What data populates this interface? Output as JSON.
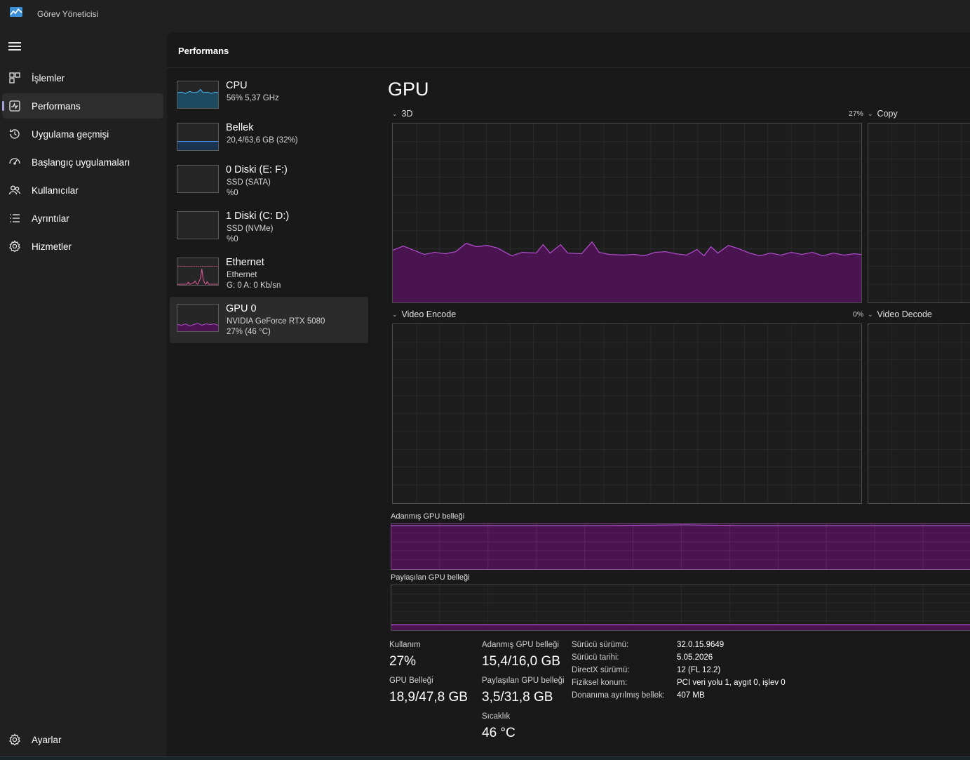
{
  "window": {
    "title": "Görev Yöneticisi"
  },
  "nav": {
    "items": [
      {
        "label": "İşlemler",
        "icon": "processes-icon"
      },
      {
        "label": "Performans",
        "icon": "performance-icon",
        "active": true
      },
      {
        "label": "Uygulama geçmişi",
        "icon": "history-icon"
      },
      {
        "label": "Başlangıç uygulamaları",
        "icon": "startup-icon"
      },
      {
        "label": "Kullanıcılar",
        "icon": "users-icon"
      },
      {
        "label": "Ayrıntılar",
        "icon": "details-icon"
      },
      {
        "label": "Hizmetler",
        "icon": "services-icon"
      }
    ],
    "settings_label": "Ayarlar"
  },
  "page": {
    "title": "Performans"
  },
  "resources": [
    {
      "name": "CPU",
      "sub1": "56% 5,37 GHz",
      "sub2": "",
      "color": "#4cc2ff"
    },
    {
      "name": "Bellek",
      "sub1": "20,4/63,6 GB (32%)",
      "sub2": "",
      "color": "#4ea1f7"
    },
    {
      "name": "0 Diski (E: F:)",
      "sub1": "SSD (SATA)",
      "sub2": "%0",
      "color": "#7a7a7a"
    },
    {
      "name": "1 Diski (C: D:)",
      "sub1": "SSD (NVMe)",
      "sub2": "%0",
      "color": "#7a7a7a"
    },
    {
      "name": "Ethernet",
      "sub1": "Ethernet",
      "sub2": "G: 0 A: 0 Kb/sn",
      "color": "#e85d9f"
    },
    {
      "name": "GPU 0",
      "sub1": "NVIDIA GeForce RTX 5080",
      "sub2": "27%  (46 °C)",
      "color": "#b64fd4",
      "selected": true
    }
  ],
  "detail": {
    "title": "GPU",
    "engines": [
      {
        "label": "3D",
        "percent": "27%",
        "usage": 27
      },
      {
        "label": "Copy"
      },
      {
        "label": "Video Encode",
        "percent": "0%",
        "usage": 0
      },
      {
        "label": "Video Decode"
      }
    ],
    "dedicated_memory_label": "Adanmış GPU belleği",
    "shared_memory_label": "Paylaşılan GPU belleği"
  },
  "stats": {
    "usage_label": "Kullanım",
    "usage_value": "27%",
    "gpu_memory_label": "GPU Belleği",
    "gpu_memory_value": "18,9/47,8 GB",
    "dedicated_label": "Adanmış GPU belleği",
    "dedicated_value": "15,4/16,0 GB",
    "shared_label": "Paylaşılan GPU belleği",
    "shared_value": "3,5/31,8 GB",
    "temp_label": "Sıcaklık",
    "temp_value": "46 °C"
  },
  "info": [
    {
      "key": "Sürücü sürümü:",
      "value": "32.0.15.9649"
    },
    {
      "key": "Sürücü tarihi:",
      "value": "5.05.2026"
    },
    {
      "key": "DirectX sürümü:",
      "value": "12 (FL 12.2)"
    },
    {
      "key": "Fiziksel konum:",
      "value": "PCI veri yolu 1, aygıt 0, işlev 0"
    },
    {
      "key": "Donanıma ayrılmış bellek:",
      "value": "407 MB"
    }
  ],
  "colors": {
    "accent": "#a5a2d9",
    "gpu": "#b64fd4",
    "gpu_fill": "#4a1450"
  }
}
